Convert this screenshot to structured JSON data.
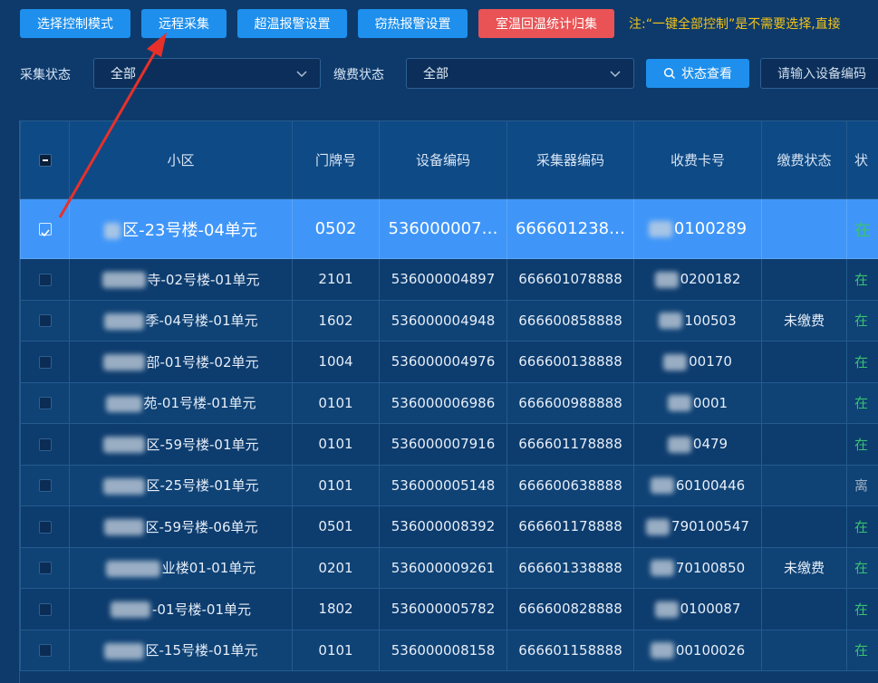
{
  "toolbar": {
    "buttons": [
      {
        "label": "选择控制模式"
      },
      {
        "label": "远程采集"
      },
      {
        "label": "超温报警设置"
      },
      {
        "label": "窃热报警设置"
      },
      {
        "label": "室温回温统计归集"
      }
    ],
    "note": "注:“一键全部控制”是不需要选择,直接"
  },
  "filters": {
    "collect_status_label": "采集状态",
    "collect_status_value": "全部",
    "pay_status_label": "缴费状态",
    "pay_status_value": "全部",
    "search_button": "状态查看",
    "device_input_placeholder": "请输入设备编码"
  },
  "table": {
    "columns": [
      "小区",
      "门牌号",
      "设备编码",
      "采集器编码",
      "收费卡号",
      "缴费状态",
      "状"
    ],
    "rows": [
      {
        "community": "区-23号楼-04单元",
        "door": "0502",
        "device": "536000007…",
        "collector": "666601238…",
        "card": "0100289",
        "pay": "",
        "status": "在",
        "selected": true
      },
      {
        "community": "寺-02号楼-01单元",
        "door": "2101",
        "device": "536000004897",
        "collector": "666601078888",
        "card": "0200182",
        "pay": "",
        "status": "在"
      },
      {
        "community": "季-04号楼-01单元",
        "door": "1602",
        "device": "536000004948",
        "collector": "666600858888",
        "card": "100503",
        "pay": "未缴费",
        "status": "在"
      },
      {
        "community": "部-01号楼-02单元",
        "door": "1004",
        "device": "536000004976",
        "collector": "666600138888",
        "card": "00170",
        "pay": "",
        "status": "在"
      },
      {
        "community": "苑-01号楼-01单元",
        "door": "0101",
        "device": "536000006986",
        "collector": "666600988888",
        "card": "0001",
        "pay": "",
        "status": "在"
      },
      {
        "community": "区-59号楼-01单元",
        "door": "0101",
        "device": "536000007916",
        "collector": "666601178888",
        "card": "0479",
        "pay": "",
        "status": "在"
      },
      {
        "community": "区-25号楼-01单元",
        "door": "0101",
        "device": "536000005148",
        "collector": "666600638888",
        "card": "60100446",
        "pay": "",
        "status": "离"
      },
      {
        "community": "区-59号楼-06单元",
        "door": "0501",
        "device": "536000008392",
        "collector": "666601178888",
        "card": "790100547",
        "pay": "",
        "status": "在"
      },
      {
        "community": "业楼01-01单元",
        "door": "0201",
        "device": "536000009261",
        "collector": "666601338888",
        "card": "70100850",
        "pay": "未缴费",
        "status": "在"
      },
      {
        "community": "-01号楼-01单元",
        "door": "1802",
        "device": "536000005782",
        "collector": "666600828888",
        "card": "0100087",
        "pay": "",
        "status": "在"
      },
      {
        "community": "区-15号楼-01单元",
        "door": "0101",
        "device": "536000008158",
        "collector": "666601158888",
        "card": "00100026",
        "pay": "",
        "status": "在"
      }
    ]
  },
  "colors": {
    "primary": "#1e8fec",
    "danger": "#e95355",
    "selected_row": "#4096f8",
    "note": "#f2c318",
    "online": "#38c172"
  }
}
